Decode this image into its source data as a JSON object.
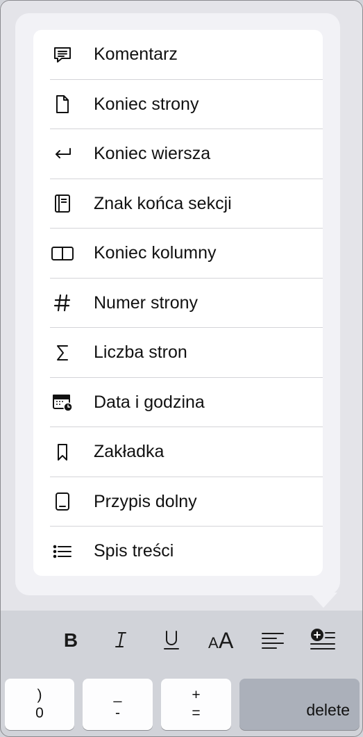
{
  "menu": {
    "items": [
      {
        "label": "Komentarz",
        "icon": "comment-icon"
      },
      {
        "label": "Koniec strony",
        "icon": "page-break-icon"
      },
      {
        "label": "Koniec wiersza",
        "icon": "line-break-icon"
      },
      {
        "label": "Znak końca sekcji",
        "icon": "section-break-icon"
      },
      {
        "label": "Koniec kolumny",
        "icon": "column-break-icon"
      },
      {
        "label": "Numer strony",
        "icon": "hash-icon"
      },
      {
        "label": "Liczba stron",
        "icon": "sigma-icon"
      },
      {
        "label": "Data i godzina",
        "icon": "calendar-clock-icon"
      },
      {
        "label": "Zakładka",
        "icon": "bookmark-icon"
      },
      {
        "label": "Przypis dolny",
        "icon": "footnote-icon"
      },
      {
        "label": "Spis treści",
        "icon": "list-icon"
      }
    ]
  },
  "toolbar": {
    "buttons": [
      "bold-icon",
      "italic-icon",
      "underline-icon",
      "font-size-icon",
      "align-left-icon",
      "insert-icon"
    ]
  },
  "keyboard": {
    "keys": [
      {
        "top": ")",
        "bottom": "0"
      },
      {
        "top": "_",
        "bottom": "-"
      },
      {
        "top": "+",
        "bottom": "="
      }
    ],
    "delete_label": "delete"
  }
}
